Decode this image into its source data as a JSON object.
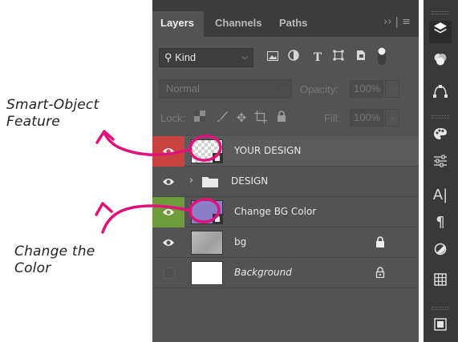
{
  "annotations": {
    "smart_object": "Smart-Object Feature",
    "smart_object_line1": "Smart-Object",
    "smart_object_line2": "Feature",
    "change_color_line1": "Change the",
    "change_color_line2": "Color",
    "arrow_color": "#e0127a"
  },
  "panel": {
    "tabs": [
      {
        "label": "Layers",
        "active": true
      },
      {
        "label": "Channels",
        "active": false
      },
      {
        "label": "Paths",
        "active": false
      }
    ],
    "menu_glyph": "›› | ≡",
    "filter": {
      "kind_label": "Kind"
    },
    "blend_mode": "Normal",
    "opacity_label": "Opacity:",
    "opacity_value": "100%",
    "lock_label": "Lock:",
    "fill_label": "Fill:",
    "fill_value": "100%",
    "layers": [
      {
        "name": "YOUR DESIGN",
        "visible": true,
        "eye_color": "#c94242",
        "type": "smart-object",
        "locked": false
      },
      {
        "name": "DESIGN",
        "visible": true,
        "eye_color": "",
        "type": "group",
        "locked": false
      },
      {
        "name": "Change BG Color",
        "visible": true,
        "eye_color": "#6e9b3c",
        "type": "smart-object",
        "thumb_color": "#8b7ec8",
        "locked": false
      },
      {
        "name": "bg",
        "visible": true,
        "eye_color": "",
        "type": "pixel",
        "locked": true
      },
      {
        "name": "Background",
        "visible": false,
        "eye_color": "",
        "type": "background",
        "locked": true
      }
    ]
  },
  "toolbar": {
    "icons": [
      "layers-icon",
      "channels-icon",
      "paths-icon",
      "color-palette-icon",
      "adjustments-icon",
      "character-icon",
      "paragraph-icon",
      "shapes-icon",
      "grid-icon",
      "artboard-icon"
    ]
  }
}
